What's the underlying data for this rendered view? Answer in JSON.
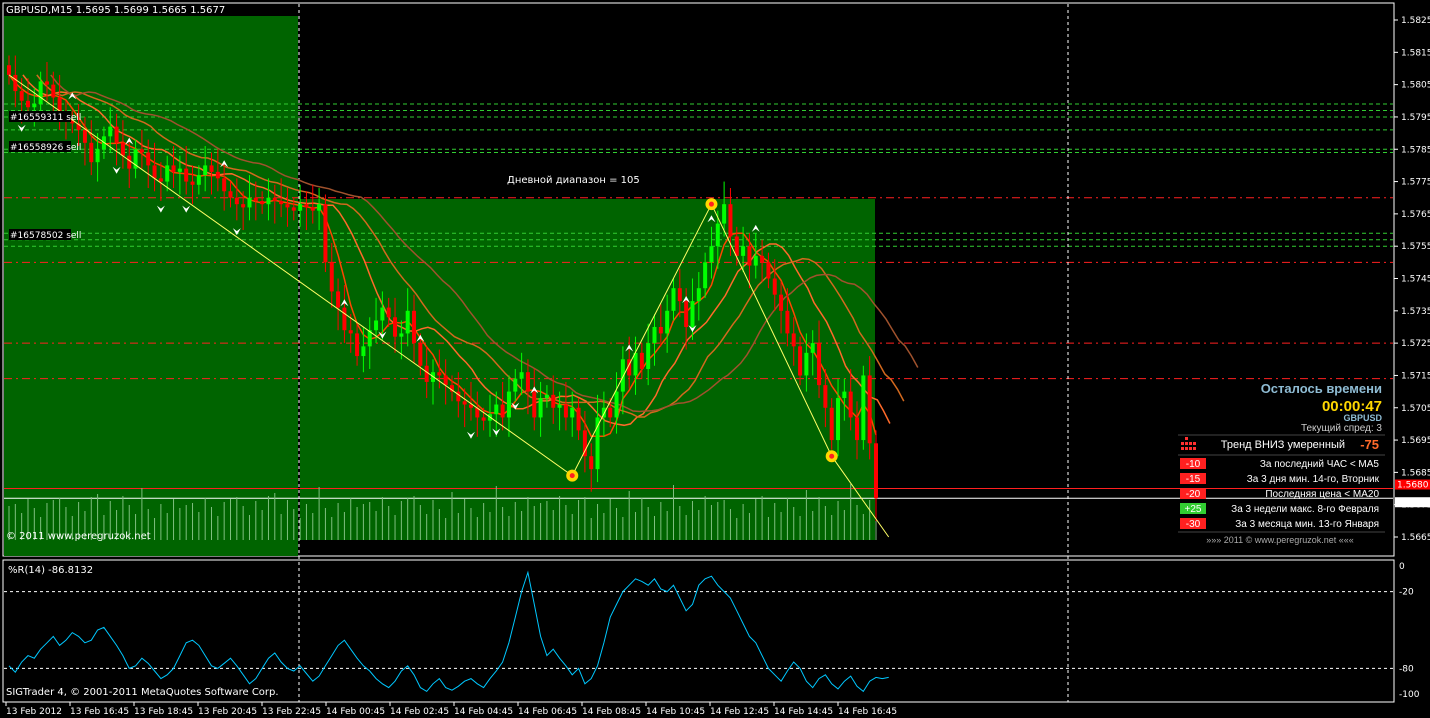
{
  "header": {
    "symbol_label": "GBPUSD,M15  1.5695 1.5699 1.5665 1.5677"
  },
  "colors": {
    "background": "#000000",
    "day_box": "#006400",
    "bull": "#00ff00",
    "bear": "#ff0000",
    "wpr_line": "#00c8ff",
    "ma_colors": [
      "#ff4500",
      "#ff6a2a",
      "#d2691e",
      "#a0522d"
    ],
    "panel_accent": "#ffd700",
    "panel_title": "#8fbcd4"
  },
  "chart_data": [
    {
      "type": "candlestick",
      "title": "GBPUSD,M15",
      "ohlc_header": {
        "open": 1.5695,
        "high": 1.5699,
        "low": 1.5665,
        "close": 1.5677
      },
      "ylim": [
        1.566,
        1.583
      ],
      "y_ticks": [
        "1.5825",
        "1.5815",
        "1.5805",
        "1.5795",
        "1.5785",
        "1.5775",
        "1.5765",
        "1.5755",
        "1.5745",
        "1.5735",
        "1.5725",
        "1.5715",
        "1.5705",
        "1.5695",
        "1.5685",
        "1.5675",
        "1.5665"
      ],
      "price_markers": [
        {
          "label": "1.5680",
          "value": 1.568,
          "color": "#ff0000"
        },
        {
          "label": "1.5677",
          "value": 1.5677,
          "color": "#ffffff"
        }
      ],
      "x_ticks": [
        "13 Feb 2012",
        "13 Feb 16:45",
        "13 Feb 18:45",
        "13 Feb 20:45",
        "13 Feb 22:45",
        "14 Feb 00:45",
        "14 Feb 02:45",
        "14 Feb 04:45",
        "14 Feb 06:45",
        "14 Feb 08:45",
        "14 Feb 10:45",
        "14 Feb 12:45",
        "14 Feb 14:45",
        "14 Feb 16:45"
      ],
      "close": [
        1.5808,
        1.5803,
        1.58,
        1.5798,
        1.5799,
        1.5806,
        1.5805,
        1.5801,
        1.5795,
        1.5794,
        1.5793,
        1.5791,
        1.5787,
        1.5781,
        1.5785,
        1.5789,
        1.5792,
        1.5787,
        1.5783,
        1.5779,
        1.5785,
        1.5784,
        1.578,
        1.5776,
        1.5775,
        1.578,
        1.5778,
        1.5779,
        1.5775,
        1.5774,
        1.5777,
        1.578,
        1.5778,
        1.5776,
        1.5772,
        1.577,
        1.5768,
        1.5767,
        1.577,
        1.5769,
        1.5768,
        1.577,
        1.5769,
        1.5768,
        1.5767,
        1.5766,
        1.5768,
        1.5767,
        1.5766,
        1.5768,
        1.575,
        1.5741,
        1.5736,
        1.5729,
        1.5728,
        1.5721,
        1.5724,
        1.5729,
        1.5732,
        1.5736,
        1.5733,
        1.5727,
        1.5728,
        1.5735,
        1.5725,
        1.5718,
        1.5713,
        1.5716,
        1.5715,
        1.5712,
        1.571,
        1.5707,
        1.5706,
        1.5705,
        1.5702,
        1.5701,
        1.5703,
        1.5706,
        1.5702,
        1.571,
        1.5714,
        1.5716,
        1.571,
        1.5702,
        1.5708,
        1.5709,
        1.5705,
        1.5706,
        1.5702,
        1.5705,
        1.5698,
        1.569,
        1.5686,
        1.5702,
        1.5705,
        1.5702,
        1.571,
        1.572,
        1.5715,
        1.5722,
        1.5717,
        1.5725,
        1.573,
        1.5728,
        1.5735,
        1.5742,
        1.5738,
        1.573,
        1.5738,
        1.5742,
        1.575,
        1.5755,
        1.5762,
        1.5768,
        1.5758,
        1.5752,
        1.5755,
        1.5749,
        1.5752,
        1.575,
        1.5745,
        1.574,
        1.5735,
        1.5728,
        1.5724,
        1.5715,
        1.5722,
        1.5725,
        1.5712,
        1.5705,
        1.5695,
        1.5708,
        1.571,
        1.5702,
        1.5695,
        1.5715,
        1.5694,
        1.5677
      ],
      "wpr": {
        "label": "%R(14) -86.8132",
        "ylim": [
          -100,
          0
        ],
        "levels": [
          -20,
          -80
        ],
        "y_ticks": [
          "0",
          "-20",
          "-80",
          "-100"
        ],
        "values": [
          -78,
          -83,
          -75,
          -70,
          -72,
          -65,
          -60,
          -55,
          -62,
          -58,
          -52,
          -55,
          -60,
          -58,
          -50,
          -48,
          -55,
          -62,
          -70,
          -80,
          -78,
          -72,
          -76,
          -82,
          -88,
          -85,
          -80,
          -70,
          -60,
          -58,
          -62,
          -70,
          -78,
          -80,
          -76,
          -72,
          -78,
          -85,
          -92,
          -88,
          -80,
          -72,
          -68,
          -75,
          -80,
          -82,
          -78,
          -84,
          -90,
          -86,
          -78,
          -70,
          -62,
          -58,
          -65,
          -72,
          -78,
          -82,
          -88,
          -92,
          -95,
          -90,
          -82,
          -78,
          -85,
          -95,
          -98,
          -92,
          -88,
          -95,
          -97,
          -94,
          -90,
          -88,
          -92,
          -95,
          -88,
          -82,
          -75,
          -60,
          -40,
          -20,
          -5,
          -30,
          -55,
          -70,
          -65,
          -72,
          -78,
          -85,
          -80,
          -92,
          -88,
          -78,
          -60,
          -40,
          -30,
          -20,
          -15,
          -10,
          -12,
          -15,
          -10,
          -18,
          -20,
          -15,
          -25,
          -35,
          -30,
          -15,
          -10,
          -8,
          -15,
          -20,
          -25,
          -35,
          -45,
          -55,
          -60,
          -70,
          -80,
          -85,
          -90,
          -82,
          -75,
          -80,
          -90,
          -95,
          -88,
          -85,
          -92,
          -96,
          -90,
          -86,
          -94,
          -98,
          -90,
          -87,
          -88,
          -87
        ]
      }
    }
  ],
  "annotations": {
    "daily_range": "Дневной диапазон = 105",
    "orders": [
      "#16558926 sell",
      "#16578502 sell",
      "#16559311 sell"
    ]
  },
  "info_panel": {
    "time_left_title": "Осталось времени",
    "time_left": "00:00:47",
    "symbol": "GBPUSD",
    "spread": "Текущий спред: 3",
    "trend_label": "Тренд ВНИЗ умеренный",
    "trend_value": "-75",
    "rows": [
      {
        "badge": "-10",
        "text": "За последний ЧАС < MA5",
        "positive": false
      },
      {
        "badge": "-15",
        "text": "За 3 дня мин. 14-го, Вторник",
        "positive": false
      },
      {
        "badge": "-20",
        "text": "Последняя цена < MA20",
        "positive": false
      },
      {
        "badge": "+25",
        "text": "За 3 недели макс. 8-го Февраля",
        "positive": true
      },
      {
        "badge": "-30",
        "text": "За 3 месяца мин. 13-го Января",
        "positive": false
      }
    ],
    "footer": "»»»    2011  ©  www.peregruzok.net    «««"
  },
  "footer": {
    "copyright": "SIGTrader 4, © 2001-2011 MetaQuotes Software Corp."
  }
}
